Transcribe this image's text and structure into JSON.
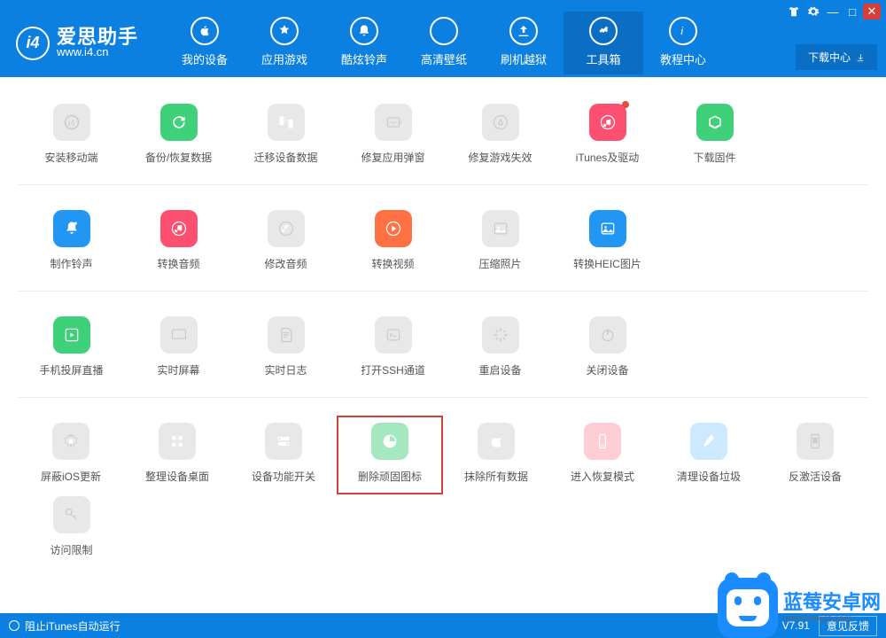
{
  "app": {
    "title": "爱思助手",
    "subtitle": "www.i4.cn",
    "version": "V7.91"
  },
  "window_controls": {
    "shirt": "👕",
    "settings": "⚙",
    "minimize": "—",
    "maximize": "□",
    "close": "✕"
  },
  "nav": [
    {
      "label": "我的设备"
    },
    {
      "label": "应用游戏"
    },
    {
      "label": "酷炫铃声"
    },
    {
      "label": "高清壁纸"
    },
    {
      "label": "刷机越狱"
    },
    {
      "label": "工具箱",
      "active": true
    },
    {
      "label": "教程中心"
    }
  ],
  "download_center": "下载中心",
  "rows": [
    [
      {
        "label": "安装移动端",
        "color": "#e8e8e8",
        "icon": "logo"
      },
      {
        "label": "备份/恢复数据",
        "color": "#3fd17a",
        "icon": "restore"
      },
      {
        "label": "迁移设备数据",
        "color": "#e8e8e8",
        "icon": "migrate"
      },
      {
        "label": "修复应用弹窗",
        "color": "#e8e8e8",
        "icon": "appleid"
      },
      {
        "label": "修复游戏失效",
        "color": "#e8e8e8",
        "icon": "appstore"
      },
      {
        "label": "iTunes及驱动",
        "color": "#fd4f6f",
        "icon": "itunes",
        "badge": true
      },
      {
        "label": "下载固件",
        "color": "#3fd17a",
        "icon": "cube"
      }
    ],
    [
      {
        "label": "制作铃声",
        "color": "#2196f3",
        "icon": "bell"
      },
      {
        "label": "转换音频",
        "color": "#fd4f6f",
        "icon": "music"
      },
      {
        "label": "修改音频",
        "color": "#e8e8e8",
        "icon": "music2"
      },
      {
        "label": "转换视频",
        "color": "#ff7043",
        "icon": "play"
      },
      {
        "label": "压缩照片",
        "color": "#e8e8e8",
        "icon": "image"
      },
      {
        "label": "转换HEIC图片",
        "color": "#2196f3",
        "icon": "heic"
      }
    ],
    [
      {
        "label": "手机投屏直播",
        "color": "#3fd17a",
        "icon": "screen"
      },
      {
        "label": "实时屏幕",
        "color": "#e8e8e8",
        "icon": "monitor"
      },
      {
        "label": "实时日志",
        "color": "#e8e8e8",
        "icon": "doc"
      },
      {
        "label": "打开SSH通道",
        "color": "#e8e8e8",
        "icon": "ssh"
      },
      {
        "label": "重启设备",
        "color": "#e8e8e8",
        "icon": "loading"
      },
      {
        "label": "关闭设备",
        "color": "#e8e8e8",
        "icon": "power"
      }
    ],
    [
      {
        "label": "屏蔽iOS更新",
        "color": "#e8e8e8",
        "icon": "gear"
      },
      {
        "label": "整理设备桌面",
        "color": "#e8e8e8",
        "icon": "grid"
      },
      {
        "label": "设备功能开关",
        "color": "#e8e8e8",
        "icon": "toggle"
      },
      {
        "label": "删除顽固图标",
        "color": "#a5e8c0",
        "icon": "pie",
        "highlight": true
      },
      {
        "label": "抹除所有数据",
        "color": "#e8e8e8",
        "icon": "apple2"
      },
      {
        "label": "进入恢复模式",
        "color": "#ffcdd6",
        "icon": "phone"
      },
      {
        "label": "清理设备垃圾",
        "color": "#cce9ff",
        "icon": "broom"
      },
      {
        "label": "反激活设备",
        "color": "#e8e8e8",
        "icon": "phone2"
      }
    ],
    [
      {
        "label": "访问限制",
        "color": "#e8e8e8",
        "icon": "key"
      }
    ]
  ],
  "status": {
    "left": "阻止iTunes自动运行",
    "feedback": "意见反馈"
  },
  "watermark": {
    "title": "蓝莓安卓网",
    "url": "www.lmkjst.com"
  }
}
